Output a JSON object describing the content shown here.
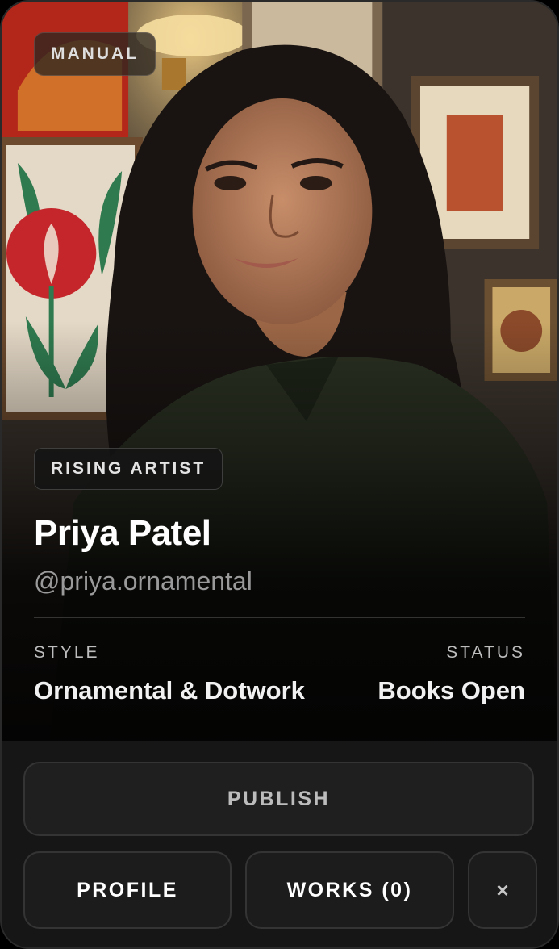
{
  "card": {
    "mode_badge": "MANUAL",
    "tier_badge": "RISING ARTIST",
    "name": "Priya Patel",
    "handle": "@priya.ornamental",
    "style_label": "STYLE",
    "style_value": "Ornamental & Dotwork",
    "status_label": "STATUS",
    "status_value": "Books Open"
  },
  "actions": {
    "publish_label": "PUBLISH",
    "profile_label": "PROFILE",
    "works_label": "WORKS (0)",
    "close_label": "×"
  },
  "colors": {
    "card_background": "#161616",
    "button_border": "#343434",
    "text_primary": "#ffffff",
    "text_muted": "#9a9a9a"
  },
  "icons": {
    "close": "close-icon"
  }
}
